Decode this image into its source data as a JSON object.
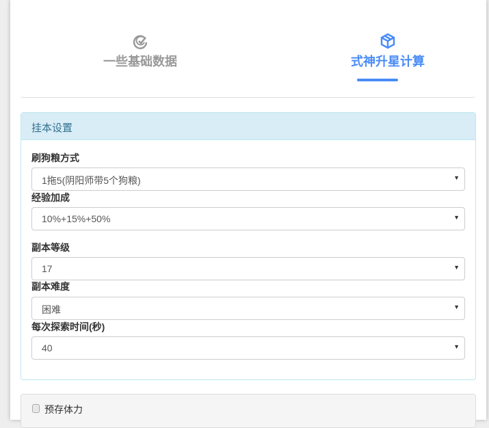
{
  "tabs": [
    {
      "label": "一些基础数据",
      "icon": "check-circle-icon"
    },
    {
      "label": "式神升星计算",
      "icon": "cube-icon",
      "active": true
    }
  ],
  "panel": {
    "title": "挂本设置",
    "fields": [
      {
        "label": "刷狗粮方式",
        "value": "1拖5(阴阳师带5个狗粮)"
      },
      {
        "label": "经验加成",
        "value": "10%+15%+50%"
      },
      {
        "label": "副本等级",
        "value": "17"
      },
      {
        "label": "副本难度",
        "value": "困难"
      },
      {
        "label": "每次探索时间(秒)",
        "value": "40"
      }
    ]
  },
  "reserve": {
    "label": "预存体力",
    "checked": false
  },
  "colors": {
    "accent": "#4a8cf7",
    "panel_header": "#d9edf7"
  }
}
